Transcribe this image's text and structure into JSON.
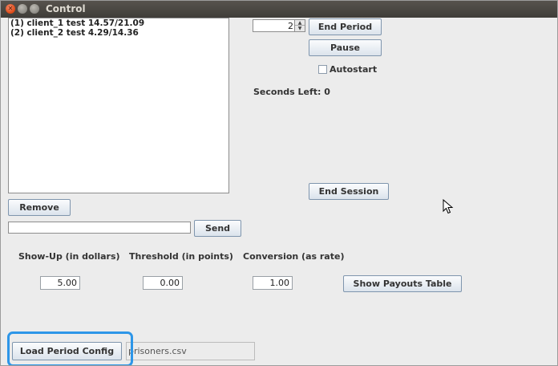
{
  "window": {
    "title": "Control",
    "close_glyph": "✕"
  },
  "clients": [
    "(1) client_1 test 14.57/21.09",
    "(2) client_2 test 4.29/14.36"
  ],
  "period": {
    "spinner_value": "2",
    "end_period_label": "End Period",
    "pause_label": "Pause",
    "autostart_label": "Autostart",
    "seconds_left": "Seconds Left: 0",
    "end_session_label": "End Session"
  },
  "list_controls": {
    "remove_label": "Remove",
    "send_label": "Send",
    "message_value": ""
  },
  "params": {
    "showup_label": "Show-Up (in dollars)",
    "showup_value": "5.00",
    "threshold_label": "Threshold (in points)",
    "threshold_value": "0.00",
    "conversion_label": "Conversion (as rate)",
    "conversion_value": "1.00",
    "payouts_label": "Show Payouts Table"
  },
  "config": {
    "load_label": "Load Period Config",
    "filename": "prisoners.csv"
  },
  "colors": {
    "highlight": "#2d96e8",
    "titlebar": "#4a4843",
    "button_border": "#7f95ad"
  },
  "icons": [
    "close-icon",
    "minimize-icon",
    "maximize-icon",
    "spinner-up-icon",
    "spinner-down-icon",
    "mouse-pointer-icon"
  ]
}
